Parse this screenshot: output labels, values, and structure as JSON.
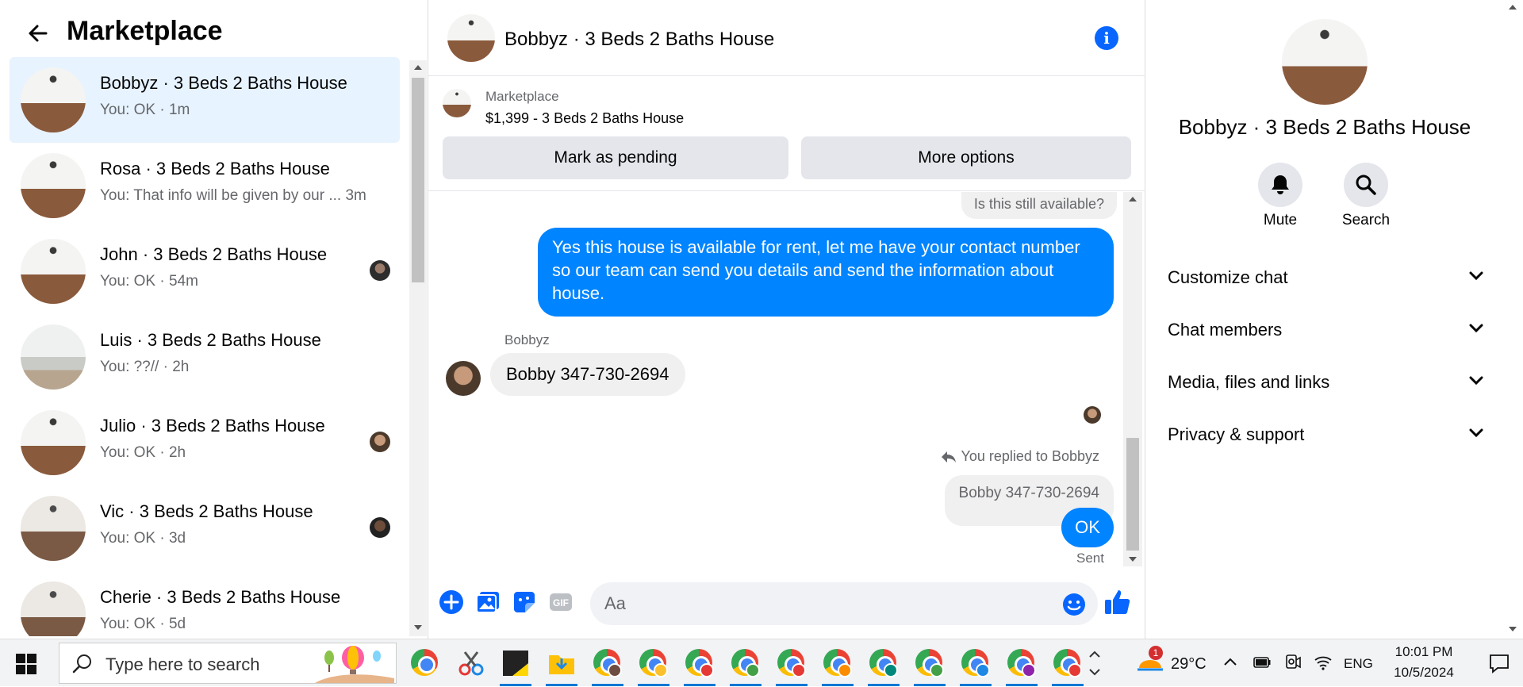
{
  "left_panel": {
    "title": "Marketplace",
    "conversations": [
      {
        "name": "Bobbyz · 3 Beds 2 Baths House",
        "preview": "You: OK · 1m",
        "active": true
      },
      {
        "name": "Rosa · 3 Beds 2 Baths House",
        "preview": "You: That info will be given by our ...  3m",
        "active": false
      },
      {
        "name": "John · 3 Beds 2 Baths House",
        "preview": "You: OK · 54m",
        "active": false
      },
      {
        "name": "Luis · 3 Beds 2 Baths House",
        "preview": "You: ??// · 2h",
        "active": false
      },
      {
        "name": "Julio · 3 Beds 2 Baths House",
        "preview": "You: OK · 2h",
        "active": false
      },
      {
        "name": "Vic · 3 Beds 2 Baths House",
        "preview": "You: OK · 3d",
        "active": false
      },
      {
        "name": "Cherie · 3 Beds 2 Baths House",
        "preview": "You: OK · 5d",
        "active": false
      }
    ]
  },
  "chat": {
    "title": "Bobbyz · 3 Beds 2 Baths House",
    "listing": {
      "label": "Marketplace",
      "price_title": "$1,399 - 3 Beds 2 Baths House"
    },
    "buttons": {
      "mark_pending": "Mark as pending",
      "more_options": "More options"
    },
    "messages": {
      "stub": "Is this still available?",
      "outgoing_1": "Yes this house is  available for rent, let me have your contact number so our team can send you details and send the information about house.",
      "sender_name": "Bobbyz",
      "incoming_1": "Bobby 347-730-2694",
      "reply_note": "You replied to Bobbyz",
      "quoted": "Bobby 347-730-2694",
      "outgoing_2": "OK",
      "status": "Sent"
    },
    "composer": {
      "placeholder": "Aa"
    }
  },
  "right_panel": {
    "title": "Bobbyz · 3 Beds 2 Baths House",
    "actions": {
      "mute": "Mute",
      "search": "Search"
    },
    "sections": [
      "Customize chat",
      "Chat members",
      "Media, files and links",
      "Privacy & support"
    ]
  },
  "taskbar": {
    "search_placeholder": "Type here to search",
    "weather": "29°C",
    "weather_badge": "1",
    "language": "ENG",
    "time": "10:01 PM",
    "date": "10/5/2024"
  },
  "colors": {
    "accent": "#0084ff",
    "active_row": "#e7f3ff",
    "secondary_text": "#65676b"
  }
}
